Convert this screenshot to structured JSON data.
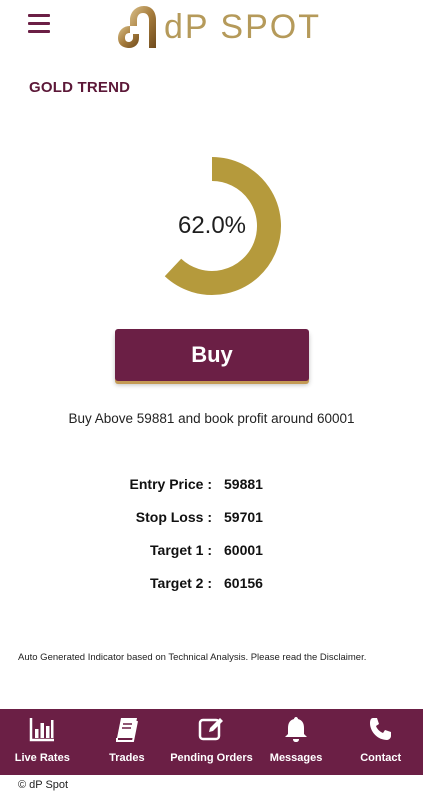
{
  "header": {
    "brand_name": "dP SPOT",
    "logo_icon": "dp-spot-logo",
    "menu_icon": "hamburger-menu-icon"
  },
  "section": {
    "title": "GOLD TREND"
  },
  "gauge": {
    "value_percent": 62.0,
    "display_text": "62.0%",
    "color": "#b59a3c"
  },
  "action": {
    "label": "Buy",
    "instruction": "Buy Above 59881 and book profit around 60001"
  },
  "levels": [
    {
      "label": "Entry Price :",
      "value": "59881"
    },
    {
      "label": "Stop Loss :",
      "value": "59701"
    },
    {
      "label": "Target 1 :",
      "value": "60001"
    },
    {
      "label": "Target 2 :",
      "value": "60156"
    }
  ],
  "disclaimer": "Auto Generated Indicator based on Technical Analysis. Please read the Disclaimer.",
  "nav": [
    {
      "label": "Live Rates",
      "icon": "bar-chart-icon"
    },
    {
      "label": "Trades",
      "icon": "book-icon"
    },
    {
      "label": "Pending Orders",
      "icon": "edit-icon"
    },
    {
      "label": "Messages",
      "icon": "bell-icon"
    },
    {
      "label": "Contact",
      "icon": "phone-icon"
    }
  ],
  "footer": "© dP Spot",
  "colors": {
    "brand": "#6b1f45",
    "gold": "#b59a5a"
  }
}
